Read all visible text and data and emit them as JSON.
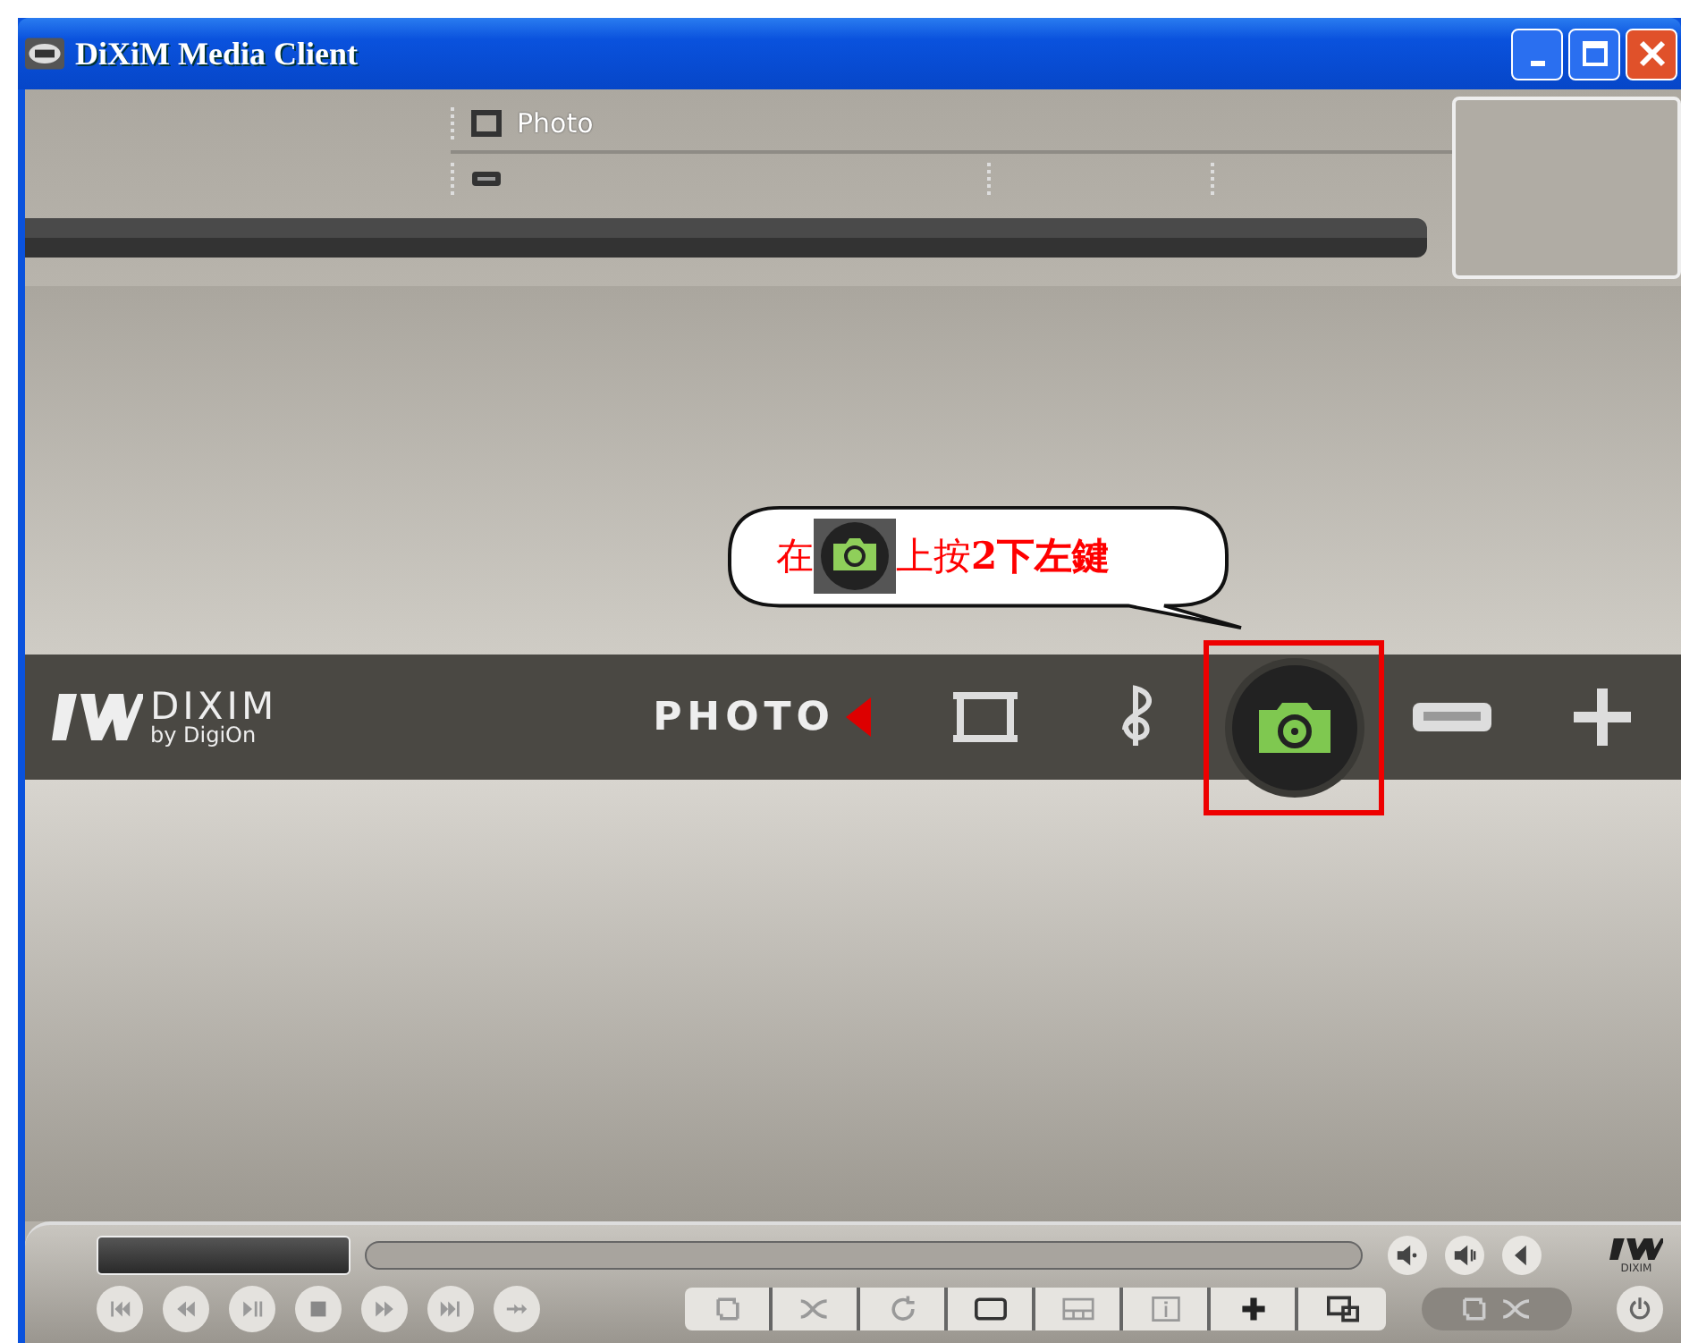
{
  "window": {
    "title": "DiXiM Media Client"
  },
  "library": {
    "header": "Photo"
  },
  "brand": {
    "name": "DIXIM",
    "sub": "by DigiOn"
  },
  "nav": {
    "label": "PHOTO",
    "items": [
      {
        "kind": "video",
        "selected": false
      },
      {
        "kind": "music",
        "selected": false
      },
      {
        "kind": "photo",
        "selected": true
      },
      {
        "kind": "device",
        "selected": false
      },
      {
        "kind": "settings",
        "selected": false
      }
    ]
  },
  "callout": {
    "before": "在",
    "after": "上按**2下左鍵**"
  },
  "player": {
    "mini_brand": "DIXIM"
  }
}
